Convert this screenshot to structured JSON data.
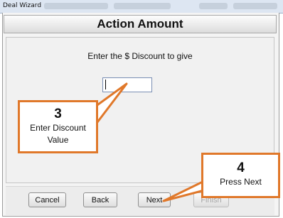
{
  "window": {
    "title": "Deal Wizard"
  },
  "header": {
    "title": "Action Amount"
  },
  "prompt": {
    "text": "Enter the $ Discount to give"
  },
  "discount_input": {
    "value": ""
  },
  "buttons": {
    "cancel": "Cancel",
    "back": "Back",
    "next": "Next",
    "finish": "Finish"
  },
  "callouts": {
    "step3": {
      "number": "3",
      "line1": "Enter Discount",
      "line2": "Value"
    },
    "step4": {
      "number": "4",
      "line1": "Press Next"
    }
  },
  "colors": {
    "callout_border": "#e0782a",
    "header_bg": "#e6e6e6",
    "input_border": "#7a8fb3"
  }
}
